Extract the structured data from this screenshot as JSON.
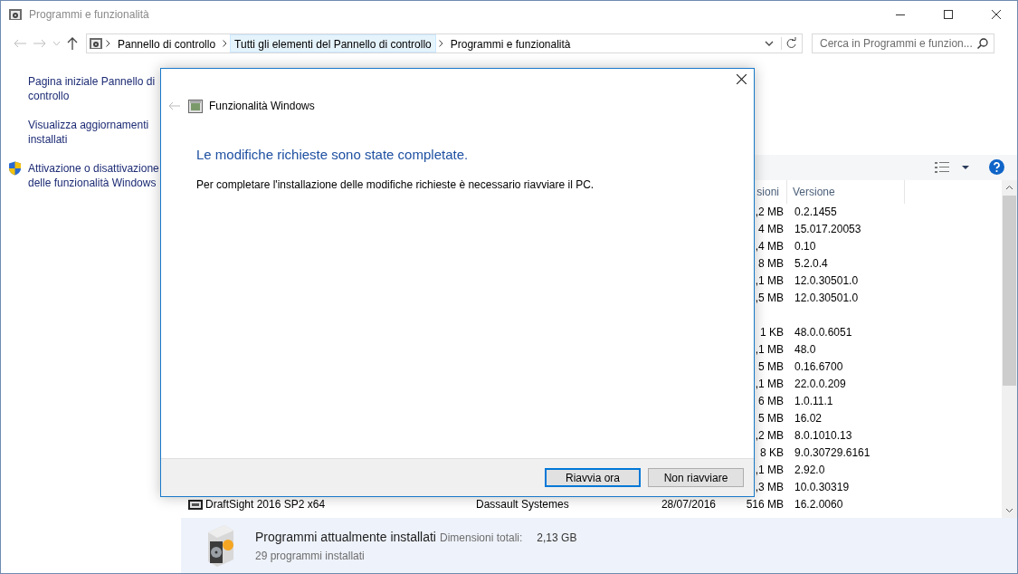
{
  "window": {
    "title": "Programmi e funzionalità"
  },
  "address_bar": {
    "breadcrumbs": [
      {
        "label": "Pannello di controllo",
        "highlighted": false
      },
      {
        "label": "Tutti gli elementi del Pannello di controllo",
        "highlighted": true
      },
      {
        "label": "Programmi e funzionalità",
        "highlighted": false
      }
    ],
    "search": {
      "placeholder": "Cerca in Programmi e funzion..."
    }
  },
  "sidebar": {
    "links": [
      {
        "label": "Pagina iniziale Pannello di controllo",
        "kind": "plain"
      },
      {
        "label": "Visualizza aggiornamenti installati",
        "kind": "plain"
      },
      {
        "label": "Attivazione o disattivazione delle funzionalità Windows",
        "kind": "shield"
      }
    ]
  },
  "program_list": {
    "columns": [
      {
        "kind": "size",
        "label": "sioni"
      },
      {
        "kind": "version",
        "label": "Versione"
      }
    ],
    "rows": [
      {
        "size": ",2 MB",
        "version": "0.2.1455"
      },
      {
        "size": "4 MB",
        "version": "15.017.20053"
      },
      {
        "size": ",4 MB",
        "version": "0.10"
      },
      {
        "size": "8 MB",
        "version": "5.2.0.4"
      },
      {
        "size": ",1 MB",
        "version": "12.0.30501.0"
      },
      {
        "size": ",5 MB",
        "version": "12.0.30501.0"
      },
      {},
      {
        "size": "1 KB",
        "version": "48.0.0.6051"
      },
      {
        "size": ",1 MB",
        "version": "48.0"
      },
      {
        "size": "5 MB",
        "version": "0.16.6700"
      },
      {
        "size": ",1 MB",
        "version": "22.0.0.209"
      },
      {
        "size": "6 MB",
        "version": "1.0.11.1"
      },
      {
        "size": "5 MB",
        "version": "16.02"
      },
      {
        "size": ",2 MB",
        "version": "8.0.1010.13"
      },
      {
        "size": "8 KB",
        "version": "9.0.30729.6161"
      },
      {
        "size": ",1 MB",
        "version": "2.92.0"
      },
      {
        "size": ",3 MB",
        "version": "10.0.30319"
      },
      {
        "name": "DraftSight 2016 SP2 x64",
        "publisher": "Dassault Systemes",
        "installed_on": "28/07/2016",
        "size": "516 MB",
        "version": "16.2.0060"
      }
    ]
  },
  "details": {
    "title": "Programmi attualmente installati",
    "size_label": "Dimensioni totali:",
    "size_value": "2,13 GB",
    "count": "29 programmi installati"
  },
  "dialog": {
    "title": "Funzionalità Windows",
    "heading": "Le modifiche richieste sono state completate.",
    "message": "Per completare l'installazione delle modifiche richieste è necessario riavviare il PC.",
    "buttons": [
      {
        "label": "Riavvia ora",
        "selected": true
      },
      {
        "label": "Non riavviare",
        "selected": false
      }
    ]
  }
}
